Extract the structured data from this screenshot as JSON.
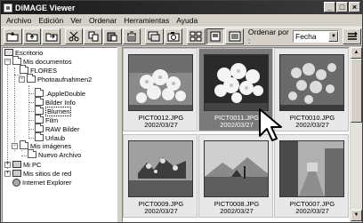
{
  "window": {
    "title": "DiMAGE Viewer",
    "controls": [
      "_",
      "□",
      "×"
    ]
  },
  "menu": [
    "Archivo",
    "Edición",
    "Ver",
    "Ordenar",
    "Herramientas",
    "Ayuda"
  ],
  "toolbar": {
    "buttons": [
      "open-folder-icon",
      "folder-up-icon",
      "folder-up-2-icon",
      "cut-icon",
      "copy-icon",
      "paste-icon",
      "delete-icon",
      "slideshow-icon",
      "camera-icon",
      "thumbnail-view-icon",
      "list-view-icon",
      "detail-view-icon"
    ],
    "sort_label": "Ordenar por :",
    "sort_value": "Fecha"
  },
  "tree": {
    "items": [
      {
        "label": "Escritorio",
        "icon": "desktop-icon"
      },
      {
        "label": "Mis documentos",
        "icon": "folder-icon",
        "expander": "−"
      },
      {
        "label": "FLORES",
        "icon": "folder-icon"
      },
      {
        "label": "Photoaufnahmen2",
        "icon": "folder-icon",
        "expander": "−"
      },
      {
        "label": ".AppleDouble",
        "icon": "folder-icon"
      },
      {
        "label": "Bilder Info",
        "icon": "folder-icon"
      },
      {
        "label": "Blumen",
        "icon": "folder-icon",
        "selected": true
      },
      {
        "label": "Film",
        "icon": "folder-icon"
      },
      {
        "label": "RAW Bilder",
        "icon": "folder-icon"
      },
      {
        "label": "Urlaub",
        "icon": "folder-icon"
      },
      {
        "label": "Mis imágenes",
        "icon": "folder-icon",
        "expander": "−"
      },
      {
        "label": "Nuevo Archivo",
        "icon": "folder-icon"
      },
      {
        "label": "Mi PC",
        "icon": "pc-icon",
        "expander": "+"
      },
      {
        "label": "Mis sitios de red",
        "icon": "network-icon",
        "expander": "+"
      },
      {
        "label": "Internet Explorer",
        "icon": "globe-icon"
      }
    ]
  },
  "thumbnails": [
    {
      "name": "PICT0012.JPG",
      "date": "2002/03/27",
      "selected": false
    },
    {
      "name": "PICT0011.JPG",
      "date": "2002/03/27",
      "selected": true
    },
    {
      "name": "PICT0010.JPG",
      "date": "2002/03/27",
      "selected": false
    },
    {
      "name": "PICT0009.JPG",
      "date": "2002/03/27",
      "selected": false
    },
    {
      "name": "PICT0008.JPG",
      "date": "2002/03/27",
      "selected": false
    },
    {
      "name": "PICT0007.JPG",
      "date": "2002/03/27",
      "selected": false
    }
  ]
}
